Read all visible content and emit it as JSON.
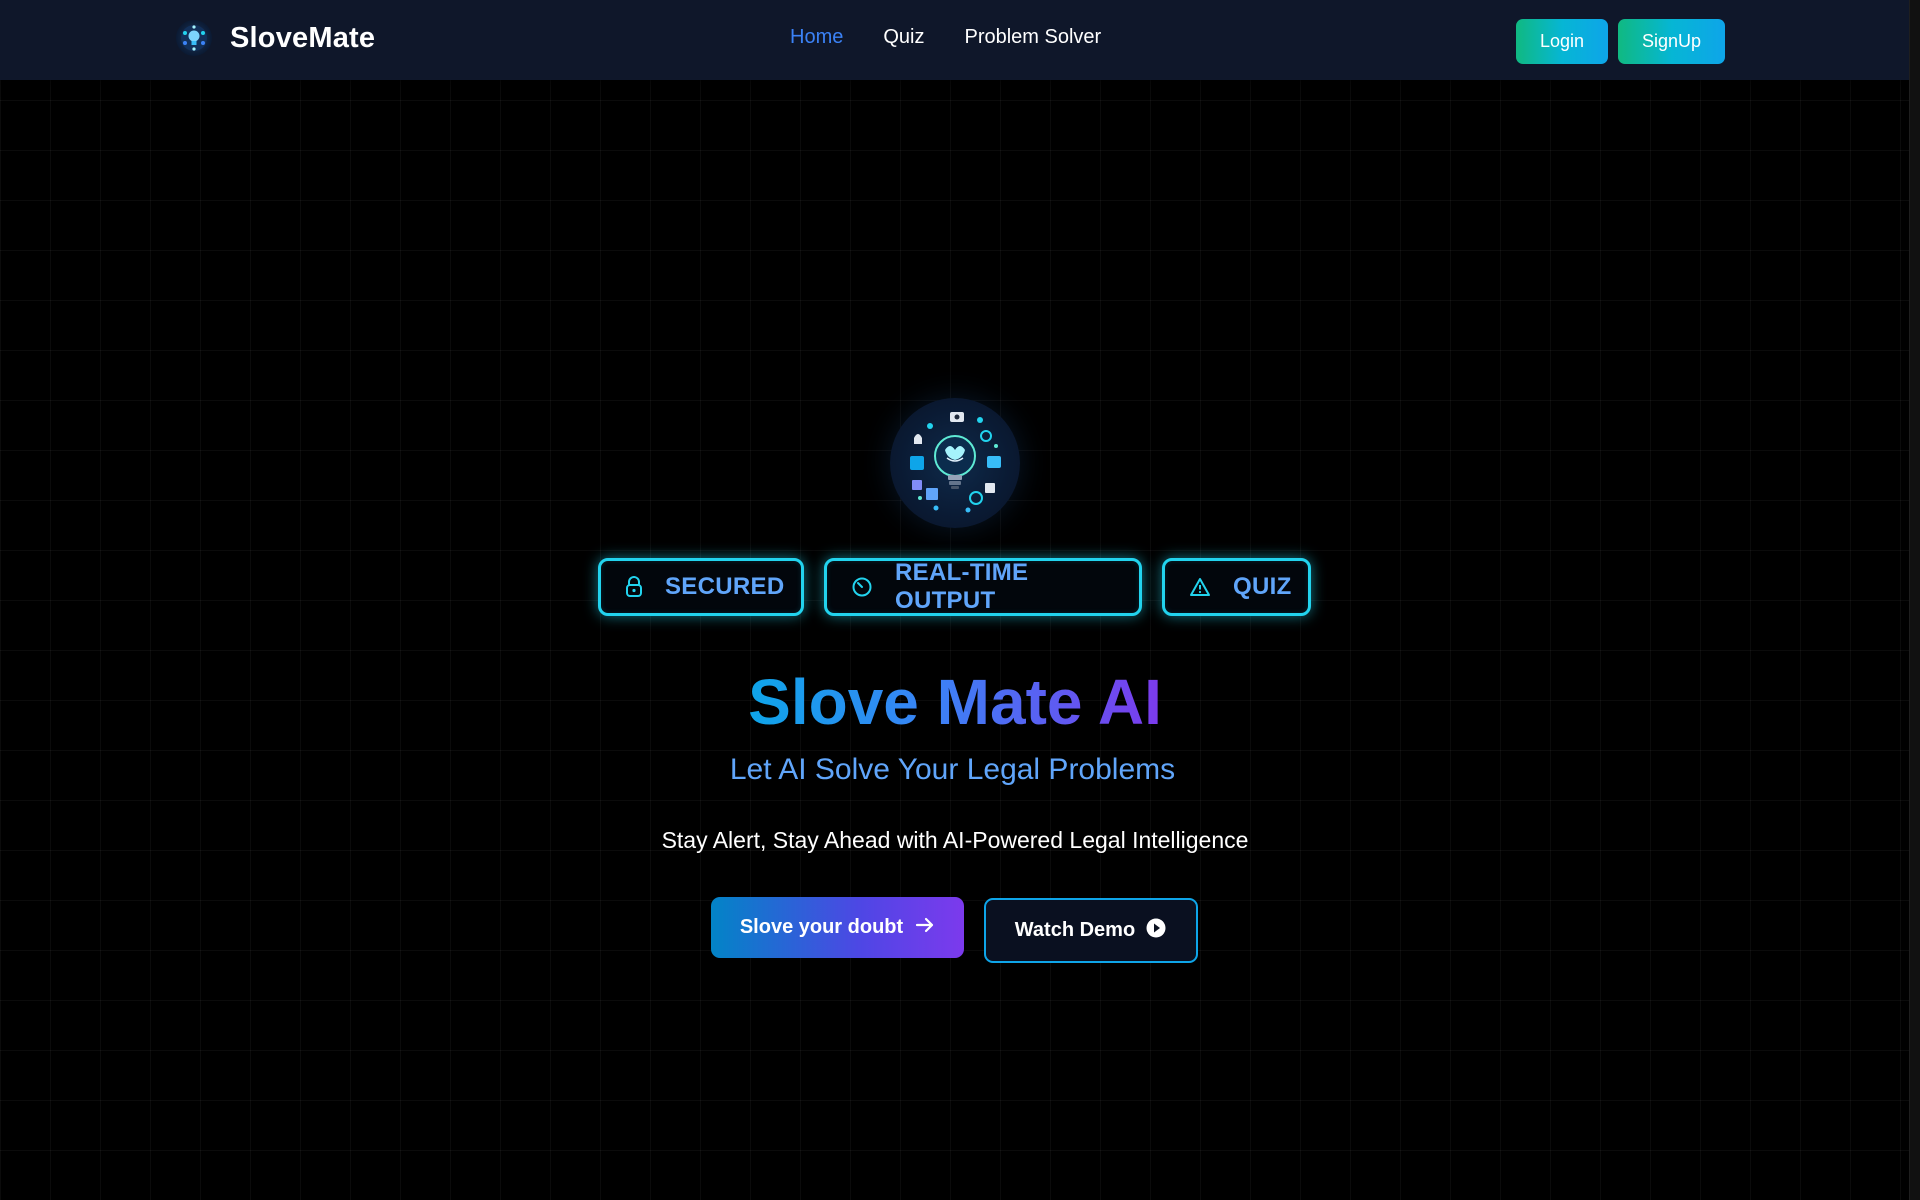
{
  "navbar": {
    "brand_name": "SloveMate",
    "links": [
      {
        "label": "Home",
        "active": true
      },
      {
        "label": "Quiz",
        "active": false
      },
      {
        "label": "Problem Solver",
        "active": false
      }
    ],
    "login_label": "Login",
    "signup_label": "SignUp"
  },
  "hero": {
    "logo_icon": "brain-lightbulb-logo",
    "badges": [
      {
        "label": "SECURED",
        "icon": "lock-icon"
      },
      {
        "label": "REAL-TIME OUTPUT",
        "icon": "timer-icon"
      },
      {
        "label": "QUIZ",
        "icon": "warning-triangle-icon"
      }
    ],
    "title": "Slove Mate AI",
    "subtitle": "Let AI Solve Your Legal Problems",
    "tagline": "Stay Alert, Stay Ahead with AI-Powered Legal Intelligence",
    "primary_cta": "Slove your doubt",
    "secondary_cta": "Watch Demo"
  },
  "colors": {
    "nav_bg": "#0f172a",
    "accent_blue": "#3b82f6",
    "badge_glow": "#22d3ee",
    "auth_gradient_start": "#10b981",
    "cta_gradient_end": "#7c3aed"
  }
}
